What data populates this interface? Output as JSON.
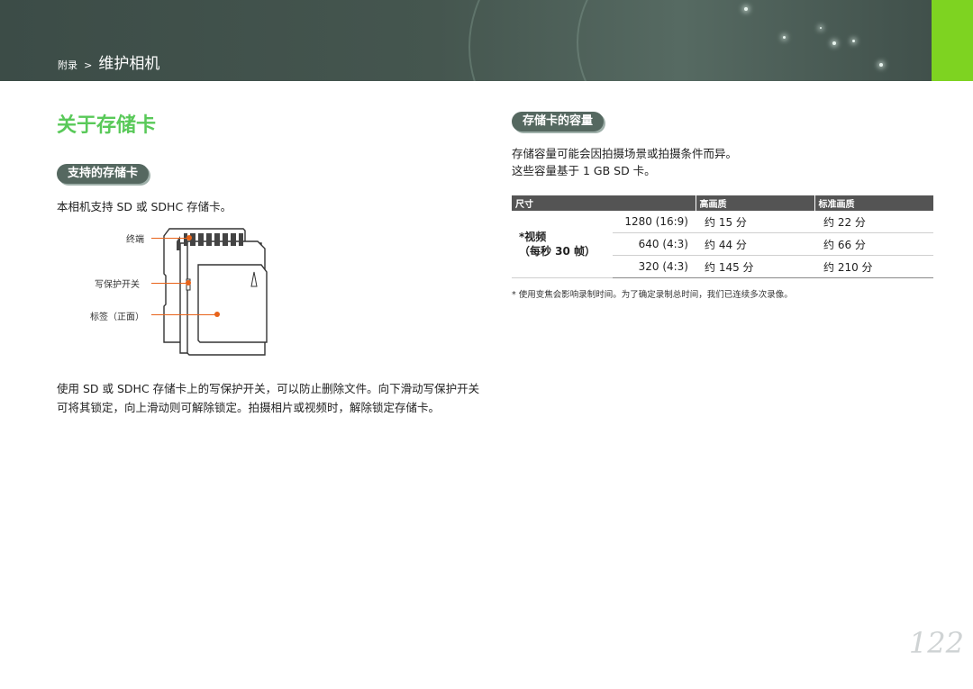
{
  "header": {
    "breadcrumb_parent": "附录",
    "breadcrumb_separator": ">",
    "breadcrumb_current": "维护相机"
  },
  "page_title": "关于存储卡",
  "left": {
    "section_title": "支持的存储卡",
    "intro": "本相机支持 SD 或 SDHC 存储卡。",
    "labels": {
      "terminal": "终端",
      "write_protect": "写保护开关",
      "label_front": "标签（正面）"
    },
    "paragraph": "使用 SD 或 SDHC 存储卡上的写保护开关，可以防止删除文件。向下滑动写保护开关可将其锁定，向上滑动则可解除锁定。拍摄相片或视频时，解除锁定存储卡。"
  },
  "right": {
    "section_title": "存储卡的容量",
    "line1": "存储容量可能会因拍摄场景或拍摄条件而异。",
    "line2": "这些容量基于 1 GB SD 卡。",
    "table": {
      "headers": [
        "尺寸",
        "高画质",
        "标准画质"
      ],
      "type_label_1": "*视频",
      "type_label_2": "（每秒 30 帧）",
      "rows": [
        {
          "size": "1280 (16:9)",
          "high": "约 15 分",
          "standard": "约 22 分"
        },
        {
          "size": "640 (4:3)",
          "high": "约 44 分",
          "standard": "约 66 分"
        },
        {
          "size": "320 (4:3)",
          "high": "约 145 分",
          "standard": "约 210 分"
        }
      ]
    },
    "footnote": "* 使用变焦会影响录制时间。为了确定录制总时间，我们已连续多次录像。"
  },
  "page_number": "122",
  "colors": {
    "accent_green": "#59c959",
    "header_bar": "#45564f",
    "pill": "#556860",
    "callout": "#e8631a"
  }
}
